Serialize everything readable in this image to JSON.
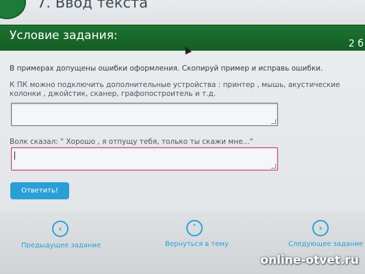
{
  "top": {
    "title": "7. Ввод текста"
  },
  "header": {
    "title": "Условие задания:",
    "count": "2 б"
  },
  "task": {
    "instruction": "В примерах допущены ошибки оформления. Скопируй пример и исправь ошибки.",
    "example1": "К ПК можно подключить дополнительные устройства : принтер , мышь, акустические колонки , джойстик, сканер, графопостроитель и т.д.",
    "example2": "Волк сказал: \" Хорошо , я отпущу тебя, только ты скажи мне...\""
  },
  "button": {
    "answer_label": "Ответить!"
  },
  "nav": {
    "prev_label": "Предыдущее задание",
    "back_label": "Вернуться в тему",
    "next_label": "Следующее задание",
    "prev_icon": "chevron-left-icon",
    "back_icon": "chevron-up-icon",
    "next_icon": "chevron-right-icon"
  },
  "watermark": "online-otvet.ru",
  "colors": {
    "header": "#1d7431",
    "accent": "#2a9fd6",
    "error_border": "#c2427b"
  }
}
